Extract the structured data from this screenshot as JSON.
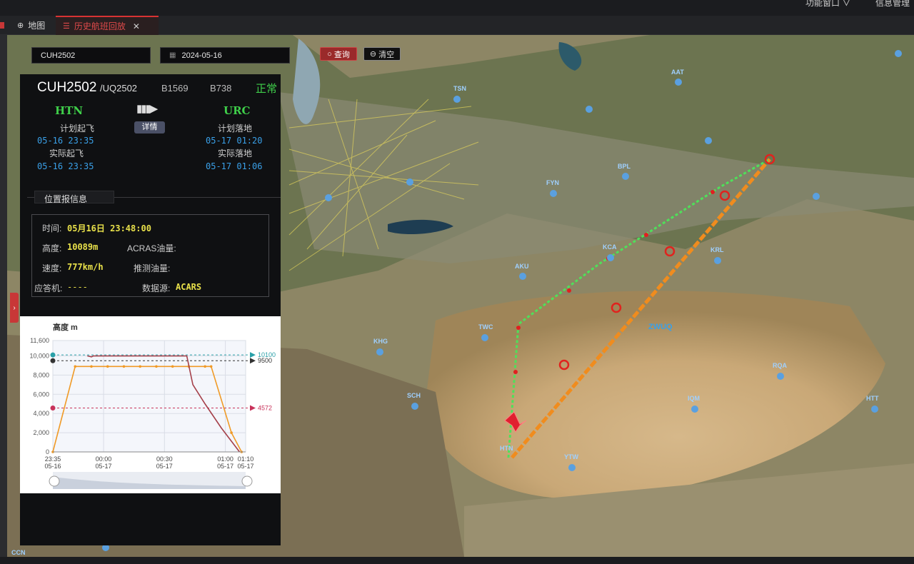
{
  "topbar": {
    "menu1": "功能窗口 ∨",
    "menu2": "信息管理"
  },
  "tabs": [
    {
      "label": "地图"
    },
    {
      "label": "历史航班回放"
    }
  ],
  "search": {
    "flight": "CUH2502",
    "date": "2024-05-16",
    "query_label": "查询",
    "clear_label": "清空"
  },
  "flight": {
    "callsign": "CUH2502",
    "alt_code": "/UQ2502",
    "reg": "B1569",
    "type": "B738",
    "status": "正常",
    "origin": "HTN",
    "dest": "URC",
    "detail_label": "详情",
    "sched_dep_label": "计划起飞",
    "sched_dep": "05-16 23:35",
    "actual_dep_label": "实际起飞",
    "actual_dep": "05-16 23:35",
    "sched_arr_label": "计划落地",
    "sched_arr": "05-17 01:20",
    "actual_arr_label": "实际落地",
    "actual_arr": "05-17 01:06"
  },
  "position": {
    "section_title": "位置报信息",
    "time_label": "时间:",
    "time": "05月16日 23:48:00",
    "alt_label": "高度:",
    "alt": "10089m",
    "acars_fuel_label": "ACRAS油量:",
    "speed_label": "速度:",
    "speed": "777km/h",
    "est_fuel_label": "推测油量:",
    "squawk_label": "应答机:",
    "squawk": "----",
    "source_label": "数据源:",
    "source": "ACARS"
  },
  "colors": {
    "accent_red": "#d83333",
    "green_text": "#3fcf4a",
    "blue_text": "#3aa0e8",
    "yellow_text": "#e8e04a",
    "route_orange": "#f08c1e",
    "route_green": "#4fe05a"
  },
  "map_labels": [
    "TSN",
    "KCA",
    "AKU",
    "TWC",
    "KHG",
    "SCH",
    "HTN",
    "YTW",
    "IQM",
    "RQA",
    "HTT",
    "KRL",
    "FYN",
    "AAT",
    "BPL",
    "CCN",
    "ZWUQ"
  ],
  "chart_data": {
    "type": "line",
    "title": "高度 m",
    "ylim": [
      0,
      11600
    ],
    "yticks": [
      0,
      2000,
      4000,
      6000,
      8000,
      10000,
      11600
    ],
    "ytick_labels": [
      "0",
      "2,000",
      "4,000",
      "6,000",
      "8,000",
      "10,000",
      "11,600"
    ],
    "xticks": [
      {
        "t": 0,
        "label1": "23:35",
        "label2": "05-16"
      },
      {
        "t": 25,
        "label1": "00:00",
        "label2": "05-17"
      },
      {
        "t": 55,
        "label1": "00:30",
        "label2": "05-17"
      },
      {
        "t": 85,
        "label1": "01:00",
        "label2": "05-17"
      },
      {
        "t": 95,
        "label1": "01:10",
        "label2": "05-17"
      }
    ],
    "xlim": [
      0,
      95
    ],
    "reference_lines": [
      {
        "value": 10100,
        "label": "10100",
        "color": "#2aa0a8"
      },
      {
        "value": 9500,
        "label": "9500",
        "color": "#333333"
      },
      {
        "value": 4572,
        "label": "4572",
        "color": "#c8325a"
      }
    ],
    "series": [
      {
        "color": "#f09a26",
        "points": [
          [
            0,
            0
          ],
          [
            11,
            8900
          ],
          [
            19,
            8900
          ],
          [
            27,
            8900
          ],
          [
            35,
            8900
          ],
          [
            43,
            8900
          ],
          [
            51,
            8900
          ],
          [
            59,
            8900
          ],
          [
            67,
            8900
          ],
          [
            75,
            8900
          ],
          [
            78,
            8900
          ],
          [
            88,
            2000
          ],
          [
            93,
            0
          ]
        ]
      },
      {
        "color": "#a5404a",
        "points": [
          [
            17,
            10000
          ],
          [
            19,
            9900
          ],
          [
            20,
            10000
          ],
          [
            30,
            10000
          ],
          [
            50,
            10000
          ],
          [
            66,
            10000
          ],
          [
            69,
            7000
          ],
          [
            75,
            5000
          ],
          [
            83,
            2500
          ],
          [
            92,
            0
          ]
        ]
      }
    ]
  }
}
